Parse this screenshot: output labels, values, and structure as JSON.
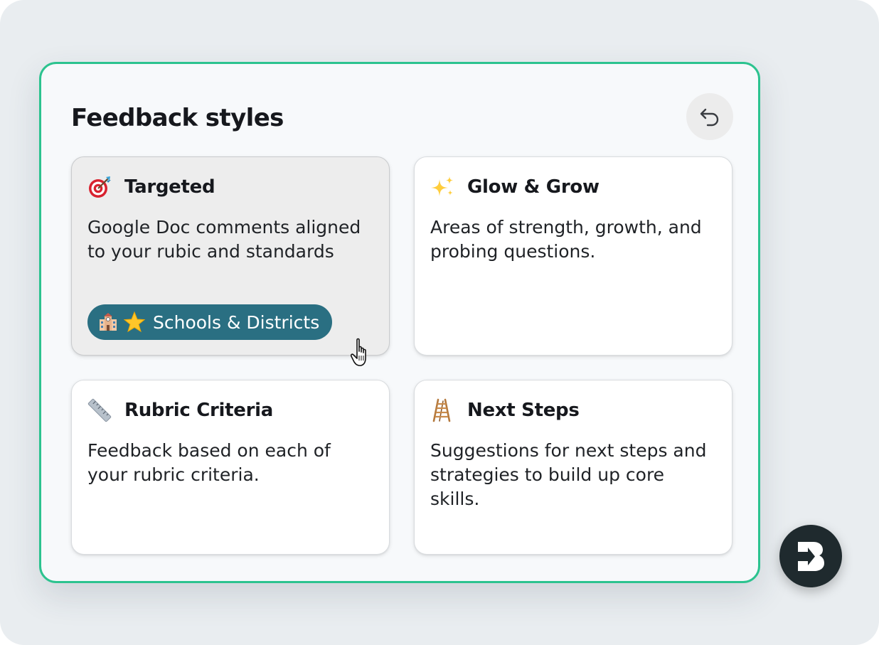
{
  "panel": {
    "title": "Feedback styles",
    "accent_color": "#2cc38f",
    "undo_icon": "undo-icon"
  },
  "cards": [
    {
      "icon": "target-icon",
      "title": "Targeted",
      "description": "Google Doc comments aligned to your rubic and standards",
      "selected": true,
      "badge": {
        "icons": [
          "school-icon",
          "star-icon"
        ],
        "label": "Schools & Districts",
        "color": "#2a6f82"
      }
    },
    {
      "icon": "sparkles-icon",
      "title": "Glow & Grow",
      "description": "Areas of strength, growth, and probing questions.",
      "selected": false
    },
    {
      "icon": "ruler-icon",
      "title": "Rubric Criteria",
      "description": "Feedback based on each of your rubric criteria.",
      "selected": false
    },
    {
      "icon": "ladder-icon",
      "title": "Next Steps",
      "description": "Suggestions for next steps and strategies to build up core skills.",
      "selected": false
    }
  ],
  "cursor": "hand-pointer-icon",
  "brand_logo": "brand-logo-icon"
}
